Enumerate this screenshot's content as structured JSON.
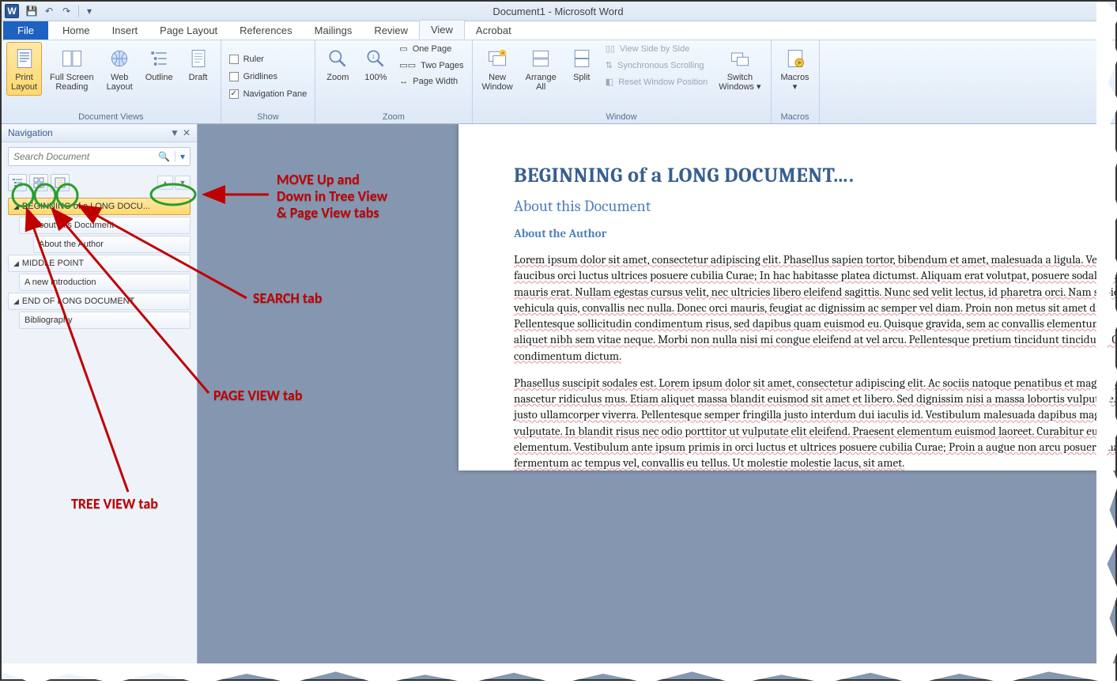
{
  "title": "Document1 - Microsoft Word",
  "qat": {
    "word": "W"
  },
  "tabs": {
    "file": "File",
    "items": [
      "Home",
      "Insert",
      "Page Layout",
      "References",
      "Mailings",
      "Review",
      "View",
      "Acrobat"
    ],
    "active": "View"
  },
  "ribbon": {
    "views": {
      "label": "Document Views",
      "print_layout": "Print\nLayout",
      "full_screen": "Full Screen\nReading",
      "web_layout": "Web\nLayout",
      "outline": "Outline",
      "draft": "Draft"
    },
    "show": {
      "label": "Show",
      "ruler": "Ruler",
      "gridlines": "Gridlines",
      "nav_pane": "Navigation Pane"
    },
    "zoom": {
      "label": "Zoom",
      "zoom": "Zoom",
      "hundred": "100%",
      "one_page": "One Page",
      "two_pages": "Two Pages",
      "page_width": "Page Width"
    },
    "window": {
      "label": "Window",
      "new_window": "New\nWindow",
      "arrange_all": "Arrange\nAll",
      "split": "Split",
      "side_by_side": "View Side by Side",
      "sync_scroll": "Synchronous Scrolling",
      "reset_pos": "Reset Window Position",
      "switch": "Switch\nWindows"
    },
    "macros": {
      "label": "Macros",
      "macros": "Macros"
    }
  },
  "nav": {
    "title": "Navigation",
    "search_placeholder": "Search Document",
    "tree": [
      {
        "level": 0,
        "text": "BEGINNING of a LONG DOCU...",
        "selected": true,
        "collapsible": true
      },
      {
        "level": 1,
        "text": "About this Document",
        "collapsible": true
      },
      {
        "level": 2,
        "text": "About the Author"
      },
      {
        "level": 0,
        "text": "MIDDLE POINT",
        "collapsible": true
      },
      {
        "level": 1,
        "text": "A new Introduction"
      },
      {
        "level": 0,
        "text": "END OF LONG DOCUMENT",
        "collapsible": true
      },
      {
        "level": 1,
        "text": "Bibliography"
      }
    ]
  },
  "doc": {
    "h1": "BEGINNING of a LONG DOCUMENT….",
    "h2": "About this Document",
    "h3": "About the Author",
    "p1": "Lorem ipsum dolor sit amet, consectetur adipiscing elit. Phasellus sapien tortor, bibendum et amet, malesuada a ligula. Vestibulum ante ipsum primis in faucibus orci luctus ultrices posuere cubilia Curae; In hac habitasse platea dictumst. Aliquam erat volutpat, posuere sodales justo ut mollis. Curabitur eu mauris erat. Nullam egestas cursus velit, nec ultricies libero eleifend sagittis. Nunc sed velit lectus, id pharetra orci. Nam sapien massa tincidunt in vehicula quis, convallis nec nulla. Donec orci mauris, feugiat ac dignissim ac semper vel diam. Proin non metus sit amet diam accumsan eleifend. Pellentesque sollicitudin condimentum risus, sed dapibus quam euismod eu. Quisque gravida, sem ac convallis elementum, turpis elit iaculis lectus, eu aliquet nibh sem vitae neque. Morbi non nulla nisi mi congue eleifend at vel arcu. Pellentesque pretium tincidunt tincidunt. Quisque malesuada condimentum dictum.",
    "p2": "Phasellus suscipit sodales est. Lorem ipsum dolor sit amet, consectetur adipiscing elit. Ac sociis natoque penatibus et magnis dis parturient montes, nascetur ridiculus mus. Etiam aliquet massa blandit euismod sit amet et libero. Sed dignissim nisi a massa lobortis vulputate. Vivamus malesuada dui in justo ullamcorper viverra. Pellentesque semper fringilla justo interdum dui iaculis id. Vestibulum malesuada dapibus magna, eget lacinia enim vulputate. In blandit risus nec odio porttitor ut vulputate elit eleifend. Praesent elementum euismod laoreet. Curabitur euismod tempor lectus a elementum. Vestibulum ante ipsum primis in orci luctus et ultrices posuere cubilia Curae; Proin a augue non arcu posuere mattis. Etiam eros, fermentum ac tempus vel, convallis eu tellus. Ut molestie molestie lacus, sit amet."
  },
  "annotations": {
    "move": "MOVE Up and\nDown in Tree View\n& Page View tabs",
    "search": "SEARCH tab",
    "page_view": "PAGE VIEW tab",
    "tree_view": "TREE VIEW tab"
  }
}
